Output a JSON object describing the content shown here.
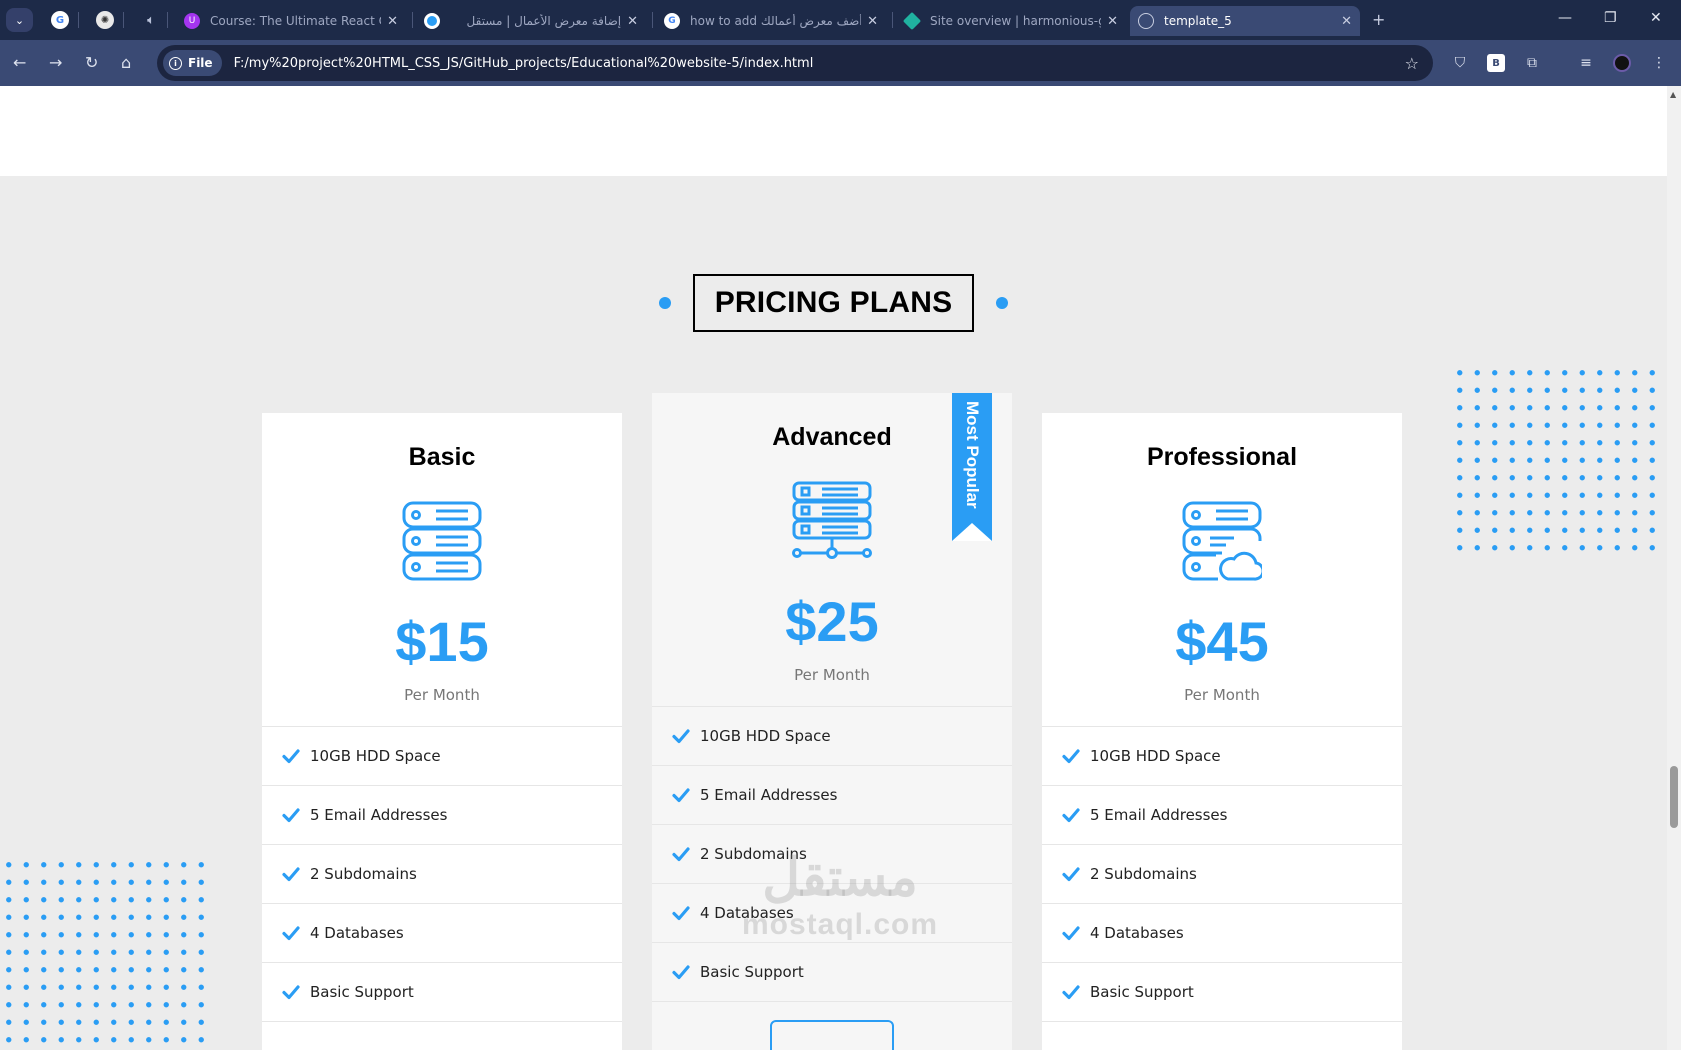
{
  "browser": {
    "tabs": [
      {
        "title": "Course: The Ultimate React Cou",
        "favicon": "course-icon",
        "active": false
      },
      {
        "title": "إضافة معرض الأعمال | مستقل",
        "favicon": "mostaql-icon",
        "active": false
      },
      {
        "title": "how to add أضف معرض أعمالك",
        "favicon": "google-icon",
        "active": false
      },
      {
        "title": "Site overview | harmonious-ge",
        "favicon": "netlify-icon",
        "active": false
      },
      {
        "title": "template_5",
        "favicon": "globe-icon",
        "active": true
      }
    ],
    "address": {
      "chip_label": "File",
      "url": "F:/my%20project%20HTML_CSS_JS/GitHub_projects/Educational%20website-5/index.html"
    }
  },
  "page": {
    "section_title": "PRICING PLANS",
    "plans": [
      {
        "name": "Basic",
        "icon": "server-icon",
        "price": "$15",
        "period": "Per Month",
        "features": [
          "10GB HDD Space",
          "5 Email Addresses",
          "2 Subdomains",
          "4 Databases",
          "Basic Support"
        ]
      },
      {
        "name": "Advanced",
        "icon": "server-network-icon",
        "price": "$25",
        "period": "Per Month",
        "ribbon": "Most Popular",
        "features": [
          "10GB HDD Space",
          "5 Email Addresses",
          "2 Subdomains",
          "4 Databases",
          "Basic Support"
        ]
      },
      {
        "name": "Professional",
        "icon": "server-cloud-icon",
        "price": "$45",
        "period": "Per Month",
        "features": [
          "10GB HDD Space",
          "5 Email Addresses",
          "2 Subdomains",
          "4 Databases",
          "Basic Support"
        ]
      }
    ],
    "watermark": {
      "arabic": "مستقل",
      "latin": "mostaql.com"
    }
  },
  "colors": {
    "accent": "#2a9df4",
    "chrome_dark": "#1d2a48",
    "chrome_toolbar": "#3a4a74",
    "page_bg": "#ececec"
  }
}
